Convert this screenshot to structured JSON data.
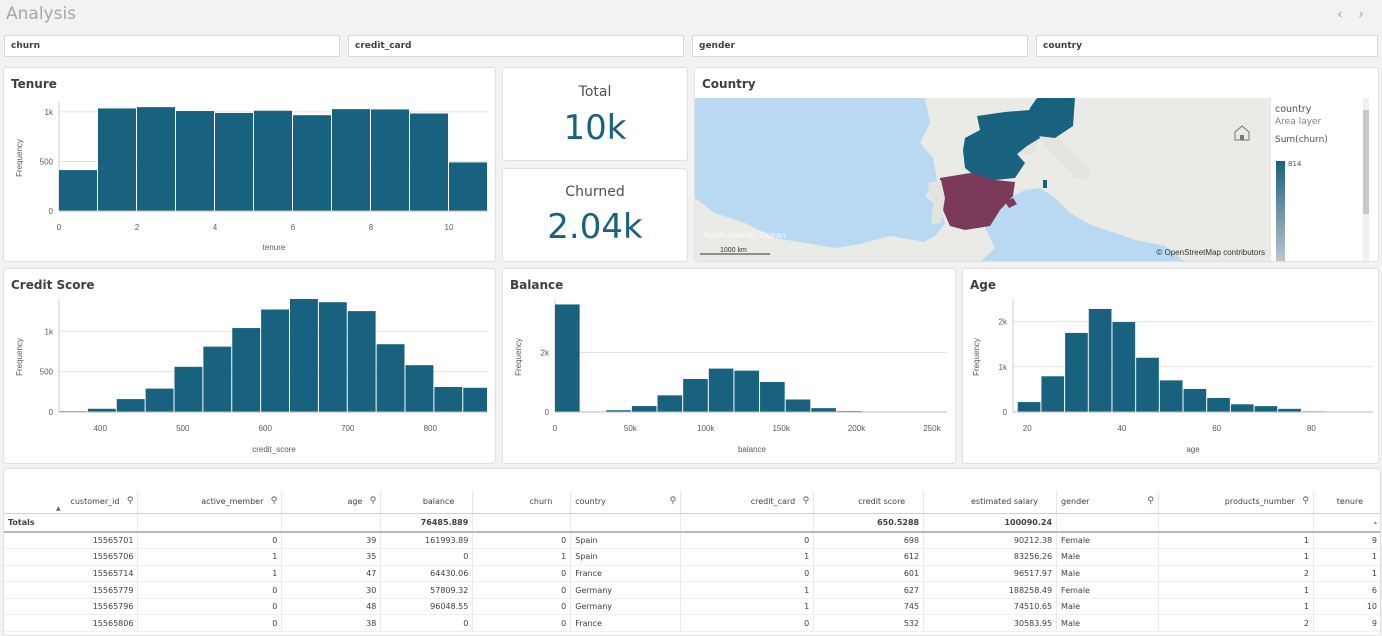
{
  "header": {
    "title": "Analysis",
    "prev_icon": "chevron-left-icon",
    "next_icon": "chevron-right-icon",
    "prev": "‹",
    "next": "›"
  },
  "filters": [
    "churn",
    "credit_card",
    "gender",
    "country"
  ],
  "colors": {
    "bar": "#19627f",
    "highlight": "#7b3a5a",
    "map_water": "#b9d8f2",
    "map_land": "#eaeae6"
  },
  "kpi": {
    "total": {
      "label": "Total",
      "value": "10k"
    },
    "churned": {
      "label": "Churned",
      "value": "2.04k"
    }
  },
  "map": {
    "title": "Country",
    "legend_title": "country",
    "legend_sub": "Area layer",
    "legend_measure": "Sum(churn)",
    "legend_max": "814",
    "ocean_label": "North Atlantic Ocean",
    "scale_label": "1000 km",
    "attribution": "© OpenStreetMap contributors",
    "home_icon": "home-icon"
  },
  "chart_data": [
    {
      "type": "bar",
      "title": "Tenure",
      "xlabel": "tenure",
      "ylabel": "Frequency",
      "x_ticks": [
        "0",
        "2",
        "4",
        "6",
        "8",
        "10"
      ],
      "y_ticks": [
        "0",
        "500",
        "1k"
      ],
      "xlim": [
        0,
        11
      ],
      "ylim": [
        0,
        1100
      ],
      "bins": [
        [
          0,
          1
        ],
        [
          1,
          2
        ],
        [
          2,
          3
        ],
        [
          3,
          4
        ],
        [
          4,
          5
        ],
        [
          5,
          6
        ],
        [
          6,
          7
        ],
        [
          7,
          8
        ],
        [
          8,
          9
        ],
        [
          9,
          10
        ],
        [
          10,
          11
        ]
      ],
      "values": [
        413,
        1035,
        1048,
        1009,
        989,
        1012,
        967,
        1028,
        1025,
        984,
        490
      ]
    },
    {
      "type": "bar",
      "title": "Credit Score",
      "xlabel": "credit_score",
      "ylabel": "Frequency",
      "x_ticks": [
        "400",
        "500",
        "600",
        "700",
        "800"
      ],
      "y_ticks": [
        "0",
        "500",
        "1k"
      ],
      "xlim": [
        350,
        870
      ],
      "ylim": [
        0,
        1400
      ],
      "bins": [
        [
          350,
          385
        ],
        [
          385,
          420
        ],
        [
          420,
          455
        ],
        [
          455,
          490
        ],
        [
          490,
          525
        ],
        [
          525,
          560
        ],
        [
          560,
          595
        ],
        [
          595,
          630
        ],
        [
          630,
          665
        ],
        [
          665,
          700
        ],
        [
          700,
          735
        ],
        [
          735,
          770
        ],
        [
          770,
          805
        ],
        [
          805,
          840
        ],
        [
          840,
          870
        ]
      ],
      "values": [
        10,
        40,
        160,
        290,
        560,
        810,
        1040,
        1270,
        1400,
        1360,
        1250,
        840,
        580,
        310,
        300
      ]
    },
    {
      "type": "bar",
      "title": "Balance",
      "xlabel": "balance",
      "ylabel": "Frequency",
      "x_ticks": [
        "0",
        "50k",
        "100k",
        "150k",
        "200k",
        "250k"
      ],
      "y_ticks": [
        "0",
        "2k"
      ],
      "xlim": [
        0,
        260000
      ],
      "ylim": [
        0,
        3800
      ],
      "bins": [
        [
          0,
          17000
        ],
        [
          17000,
          34000
        ],
        [
          34000,
          51000
        ],
        [
          51000,
          68000
        ],
        [
          68000,
          85000
        ],
        [
          85000,
          102000
        ],
        [
          102000,
          119000
        ],
        [
          119000,
          136000
        ],
        [
          136000,
          153000
        ],
        [
          153000,
          170000
        ],
        [
          170000,
          187000
        ],
        [
          187000,
          204000
        ],
        [
          204000,
          221000
        ],
        [
          221000,
          238000
        ],
        [
          238000,
          255000
        ]
      ],
      "values": [
        3617,
        5,
        60,
        200,
        560,
        1110,
        1460,
        1390,
        1010,
        420,
        130,
        30,
        10,
        3,
        1
      ]
    },
    {
      "type": "bar",
      "title": "Age",
      "xlabel": "age",
      "ylabel": "Frequency",
      "x_ticks": [
        "20",
        "40",
        "60",
        "80"
      ],
      "y_ticks": [
        "0",
        "1k",
        "2k"
      ],
      "xlim": [
        17,
        93
      ],
      "ylim": [
        0,
        2500
      ],
      "bins": [
        [
          18,
          23
        ],
        [
          23,
          28
        ],
        [
          28,
          33
        ],
        [
          33,
          38
        ],
        [
          38,
          43
        ],
        [
          43,
          48
        ],
        [
          48,
          53
        ],
        [
          53,
          58
        ],
        [
          58,
          63
        ],
        [
          63,
          68
        ],
        [
          68,
          73
        ],
        [
          73,
          78
        ],
        [
          78,
          83
        ],
        [
          83,
          88
        ],
        [
          88,
          92
        ]
      ],
      "values": [
        220,
        790,
        1750,
        2280,
        1990,
        1200,
        700,
        510,
        310,
        170,
        130,
        70,
        15,
        5,
        2
      ]
    }
  ],
  "table": {
    "columns": [
      {
        "label": "customer_id",
        "align": "num",
        "sorted": true
      },
      {
        "label": "active_member",
        "align": "num"
      },
      {
        "label": "age",
        "align": "num"
      },
      {
        "label": "balance",
        "align": "num"
      },
      {
        "label": "churn",
        "align": "num"
      },
      {
        "label": "country",
        "align": "txt"
      },
      {
        "label": "credit_card",
        "align": "num"
      },
      {
        "label": "credit score",
        "align": "num"
      },
      {
        "label": "estimated salary",
        "align": "num"
      },
      {
        "label": "gender",
        "align": "txt"
      },
      {
        "label": "products_number",
        "align": "num"
      },
      {
        "label": "tenure",
        "align": "num"
      }
    ],
    "totals": [
      "Totals",
      "",
      "",
      "76485.889",
      "",
      "",
      "",
      "650.5288",
      "100090.24",
      "",
      "",
      "-"
    ],
    "rows": [
      [
        "15565701",
        "0",
        "39",
        "161993.89",
        "0",
        "Spain",
        "0",
        "698",
        "90212.38",
        "Female",
        "1",
        "9"
      ],
      [
        "15565706",
        "1",
        "35",
        "0",
        "1",
        "Spain",
        "1",
        "612",
        "83256.26",
        "Male",
        "1",
        "1"
      ],
      [
        "15565714",
        "1",
        "47",
        "64430.06",
        "0",
        "France",
        "0",
        "601",
        "96517.97",
        "Male",
        "2",
        "1"
      ],
      [
        "15565779",
        "0",
        "30",
        "57809.32",
        "0",
        "Germany",
        "1",
        "627",
        "188258.49",
        "Female",
        "1",
        "6"
      ],
      [
        "15565796",
        "0",
        "48",
        "96048.55",
        "0",
        "Germany",
        "1",
        "745",
        "74510.65",
        "Male",
        "1",
        "10"
      ],
      [
        "15565806",
        "0",
        "38",
        "0",
        "0",
        "France",
        "0",
        "532",
        "30583.95",
        "Male",
        "2",
        "9"
      ]
    ]
  }
}
